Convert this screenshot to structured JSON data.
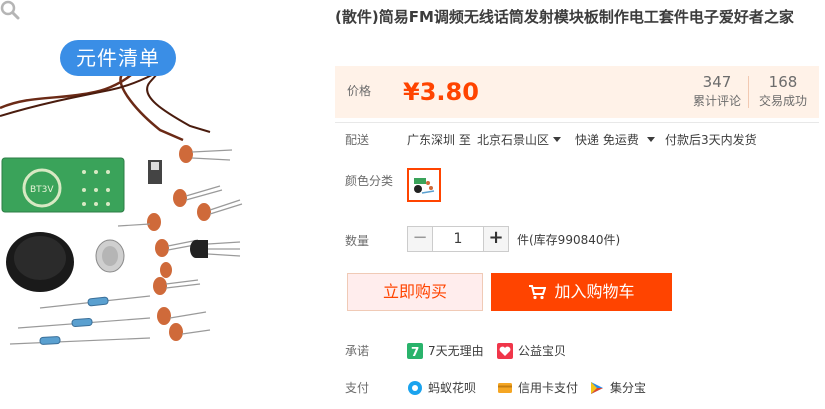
{
  "gallery": {
    "badge": "元件清单",
    "zoom_icon": "magnifier-icon",
    "board_text": "BT3V"
  },
  "product": {
    "title": "(散件)简易FM调频无线话筒发射模块板制作电工套件电子爱好者之家"
  },
  "price": {
    "label": "价格",
    "value": "¥3.80",
    "color": "#ff4400"
  },
  "stats": {
    "reviews_count": "347",
    "reviews_label": "累计评论",
    "sales_count": "168",
    "sales_label": "交易成功"
  },
  "shipping": {
    "label": "配送",
    "from": "广东深圳 至",
    "to": "北京石景山区",
    "method": "快递 免运费",
    "deadline": "付款后3天内发货"
  },
  "options": {
    "color_label": "颜色分类"
  },
  "quantity": {
    "label": "数量",
    "minus": "−",
    "value": "1",
    "plus": "+",
    "stock": "件(库存990840件)"
  },
  "actions": {
    "buy_now": "立即购买",
    "add_to_cart": "加入购物车"
  },
  "promise": {
    "label": "承诺",
    "items": [
      {
        "icon": "seven-day-return-icon",
        "label": "7天无理由"
      },
      {
        "icon": "charity-heart-icon",
        "label": "公益宝贝"
      }
    ]
  },
  "payment": {
    "label": "支付",
    "items": [
      {
        "icon": "huabei-icon",
        "label": "蚂蚁花呗"
      },
      {
        "icon": "credit-card-icon",
        "label": "信用卡支付"
      },
      {
        "icon": "jifenbao-icon",
        "label": "集分宝"
      }
    ]
  }
}
